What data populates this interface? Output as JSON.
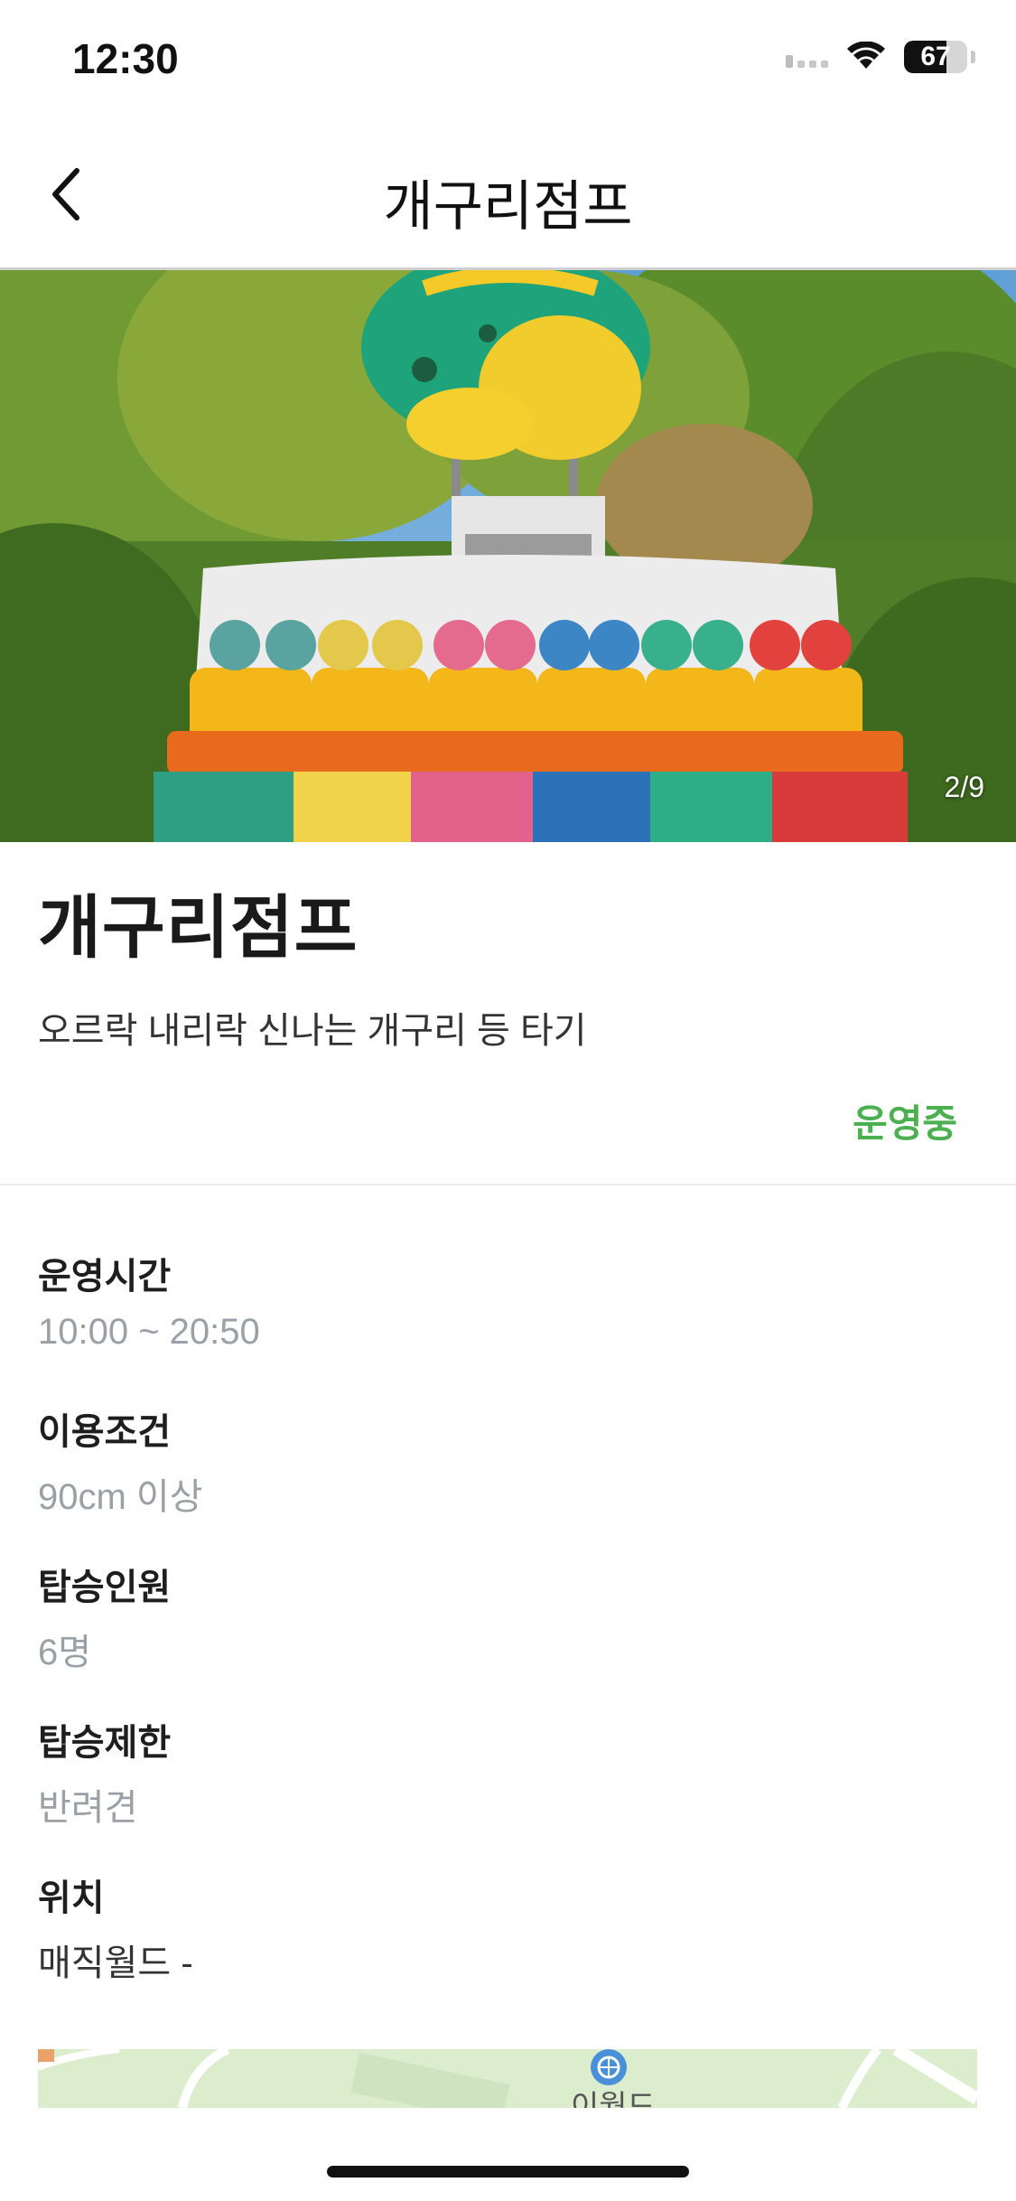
{
  "status_bar": {
    "time": "12:30",
    "battery": "67",
    "battery_level": 0.67,
    "icons": [
      "signal-icon",
      "wifi-icon",
      "battery-icon"
    ]
  },
  "header": {
    "title": "개구리점프",
    "back_icon": "chevron-left-icon"
  },
  "hero": {
    "counter": "2/9"
  },
  "ride": {
    "title": "개구리점프",
    "description": "오르락 내리락 신나는 개구리 등 타기",
    "status": "운영중",
    "status_color": "#4caf50"
  },
  "info": [
    {
      "label": "운영시간",
      "value": "10:00 ~ 20:50"
    },
    {
      "label": "이용조건",
      "value": "90cm 이상"
    },
    {
      "label": "탑승인원",
      "value": "6명"
    },
    {
      "label": "탑승제한",
      "value": "반려견"
    },
    {
      "label": "위치",
      "value": "매직월드 -"
    }
  ],
  "map": {
    "label": "이월드",
    "marker_icon": "ferris-wheel-icon"
  }
}
